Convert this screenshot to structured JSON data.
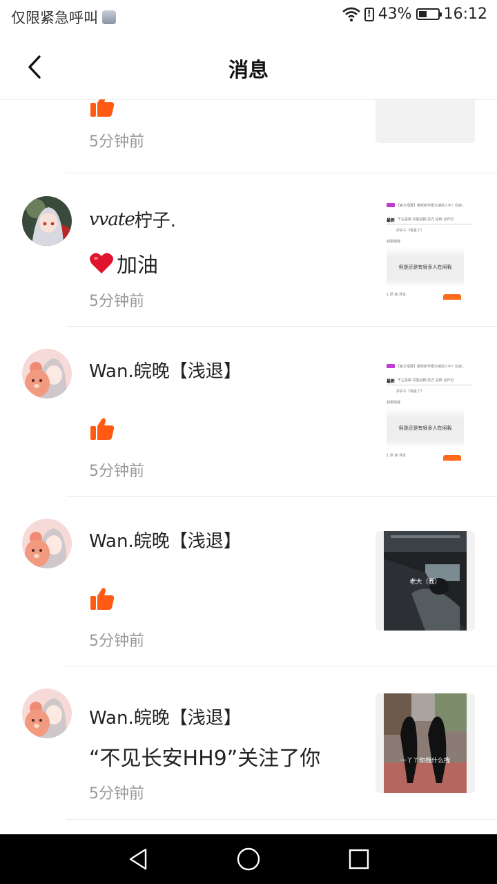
{
  "status_bar": {
    "carrier": "仅限紧急呼叫",
    "battery_percent": "43%",
    "battery_level": 0.43,
    "time": "16:12"
  },
  "header": {
    "title": "消息"
  },
  "items": [
    {
      "name": "",
      "content": "",
      "content_icon": "like-icon",
      "time": "5分钟前"
    },
    {
      "name": "柠子.",
      "name_prefix_handwriting": "vvate",
      "content": "加油",
      "content_icon": "heart-icon",
      "time": "5分钟前",
      "thumb": {
        "tab_active": "最新",
        "tabs": "千古投稿  高能投稿  前方  投稿  合作记",
        "banner": "【官方招募】楼校新作团大纳招人中！欢迎...",
        "user": "护护子《惊喜了》",
        "subtitle": "刮相瑶瑶",
        "caption": "但是还是有很多人在闲我",
        "actions": "1  评  转  评论"
      }
    },
    {
      "name": "Wan.皖晚【浅退】",
      "content": "",
      "content_icon": "like-icon",
      "time": "5分钟前",
      "thumb": {
        "tab_active": "最新",
        "tabs": "千古投稿  高能投稿  前方  投稿  合作记",
        "banner": "【官方招募】楼校新作团大纳招人中！欢迎...",
        "user": "护护子《惊喜了》",
        "subtitle": "刮相瑶瑶",
        "caption": "但是还是有很多人在闲我",
        "actions": "1  评  转  评论"
      }
    },
    {
      "name": "Wan.皖晚【浅退】",
      "content": "",
      "content_icon": "like-icon",
      "time": "5分钟前",
      "thumb": {
        "caption": "老大（我）"
      }
    },
    {
      "name": "Wan.皖晚【浅退】",
      "content": "“不见长安HH9”关注了你",
      "content_icon": "",
      "time": "5分钟前",
      "thumb": {
        "caption": "一丫丫你拽什么拽"
      }
    }
  ],
  "colors": {
    "accent": "#ff5a14",
    "heart": "#e0142c",
    "divider": "#e9e9e9"
  }
}
